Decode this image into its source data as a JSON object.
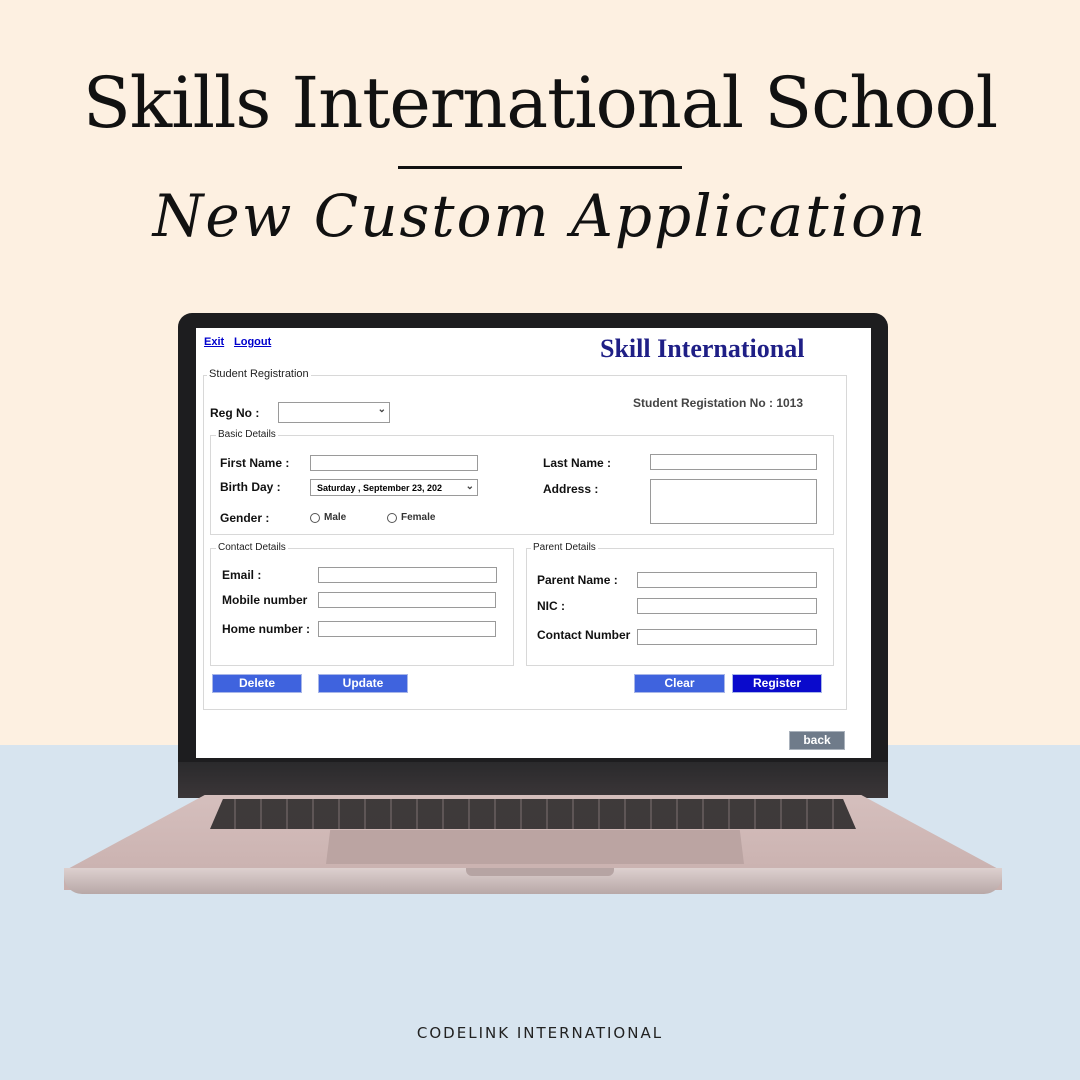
{
  "poster": {
    "headline": "Skills International School",
    "subheadline": "New Custom Application",
    "footer": "CODELINK INTERNATIONAL"
  },
  "app": {
    "links": {
      "exit": "Exit",
      "logout": "Logout"
    },
    "title": "Skill International",
    "student_registration": {
      "group_label": "Student Registration",
      "reg_no_label": "Reg No :",
      "reg_no_value": "",
      "registration_number_text": "Student Registation No : 1013"
    },
    "basic_details": {
      "group_label": "Basic Details",
      "first_name_label": "First Name :",
      "first_name_value": "",
      "last_name_label": "Last Name :",
      "last_name_value": "",
      "birth_day_label": "Birth Day :",
      "birth_day_value": "Saturday  , September 23, 202",
      "address_label": "Address :",
      "address_value": "",
      "gender_label": "Gender :",
      "gender_options": [
        "Male",
        "Female"
      ]
    },
    "contact_details": {
      "group_label": "Contact Details",
      "email_label": "Email :",
      "email_value": "",
      "mobile_label": "Mobile number",
      "mobile_value": "",
      "home_label": "Home number :",
      "home_value": ""
    },
    "parent_details": {
      "group_label": "Parent Details",
      "parent_name_label": "Parent Name :",
      "parent_name_value": "",
      "nic_label": "NIC :",
      "nic_value": "",
      "contact_number_label": "Contact Number",
      "contact_number_value": ""
    },
    "buttons": {
      "delete": "Delete",
      "update": "Update",
      "clear": "Clear",
      "register": "Register",
      "back": "back"
    }
  },
  "icons": {
    "dropdown": "chevron-down-icon",
    "radio": "radio-icon"
  },
  "colors": {
    "background_top": "#fdf0e1",
    "background_bottom": "#d7e4ef",
    "app_title": "#1f1f86",
    "button_blue": "#3f63de",
    "button_register": "#0a0acc",
    "button_back": "#6f7b8a",
    "link": "#0000cc"
  }
}
